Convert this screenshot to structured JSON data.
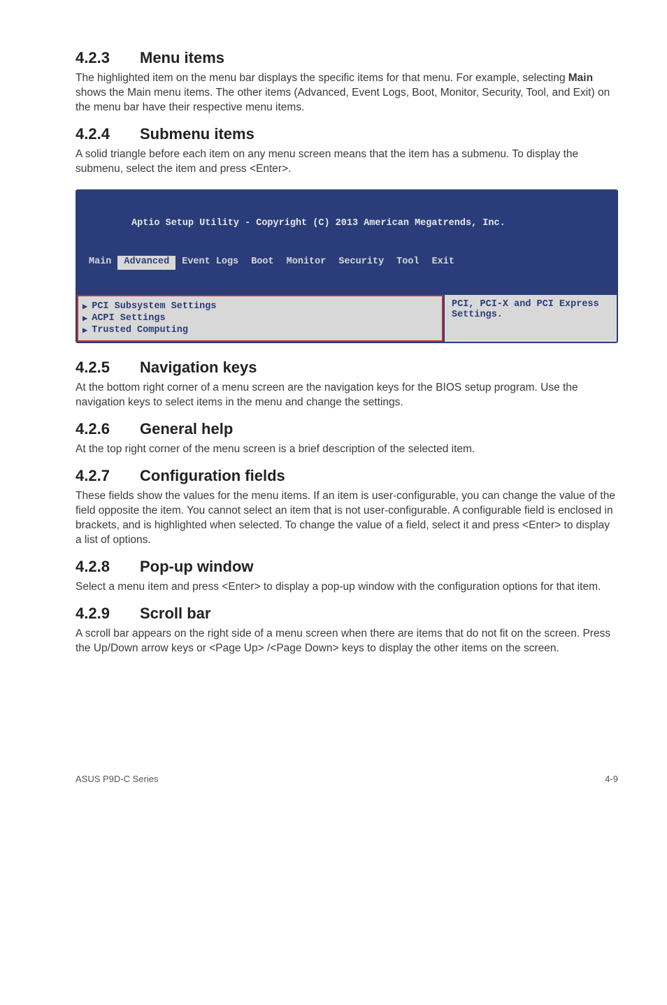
{
  "sections": {
    "s423": {
      "num": "4.2.3",
      "title": "Menu items",
      "body_a": "The highlighted item on the menu bar displays the specific items for that menu. For example, selecting ",
      "body_b": "Main",
      "body_c": " shows the Main menu items. The other items (Advanced, Event Logs, Boot, Monitor, Security, Tool, and Exit) on the menu bar have their respective menu items."
    },
    "s424": {
      "num": "4.2.4",
      "title": "Submenu items",
      "body": "A solid triangle before each item on any menu screen means that the item has a submenu. To display the submenu, select the item and press <Enter>."
    },
    "s425": {
      "num": "4.2.5",
      "title": "Navigation keys",
      "body": "At the bottom right corner of a menu screen are the navigation keys for the BIOS setup program. Use the navigation keys to select items in the menu and change the settings."
    },
    "s426": {
      "num": "4.2.6",
      "title": "General help",
      "body": "At the top right corner of the menu screen is a brief description of the selected item."
    },
    "s427": {
      "num": "4.2.7",
      "title": "Configuration fields",
      "body": "These fields show the values for the menu items. If an item is user-configurable, you can change the value of the field opposite the item. You cannot select an item that is not user-configurable. A configurable field is enclosed in brackets, and is highlighted when selected. To change the value of a field, select it and press <Enter> to display a list of options."
    },
    "s428": {
      "num": "4.2.8",
      "title": "Pop-up window",
      "body": "Select a menu item and press <Enter> to display a pop-up window with the configuration options for that item."
    },
    "s429": {
      "num": "4.2.9",
      "title": "Scroll bar",
      "body": "A scroll bar appears on the right side of a menu screen when there are items that do not fit on the screen. Press the Up/Down arrow keys or <Page Up> /<Page Down> keys to display the other items on the screen."
    }
  },
  "bios": {
    "title": "Aptio Setup Utility - Copyright (C) 2013 American Megatrends, Inc.",
    "tabs": [
      "Main",
      "Advanced",
      "Event Logs",
      "Boot",
      "Monitor",
      "Security",
      "Tool",
      "Exit"
    ],
    "active_tab_index": 1,
    "items": [
      "PCI Subsystem Settings",
      "ACPI Settings",
      "Trusted Computing"
    ],
    "help": "PCI, PCI-X and PCI Express Settings."
  },
  "footer": {
    "left": "ASUS P9D-C Series",
    "right": "4-9"
  }
}
